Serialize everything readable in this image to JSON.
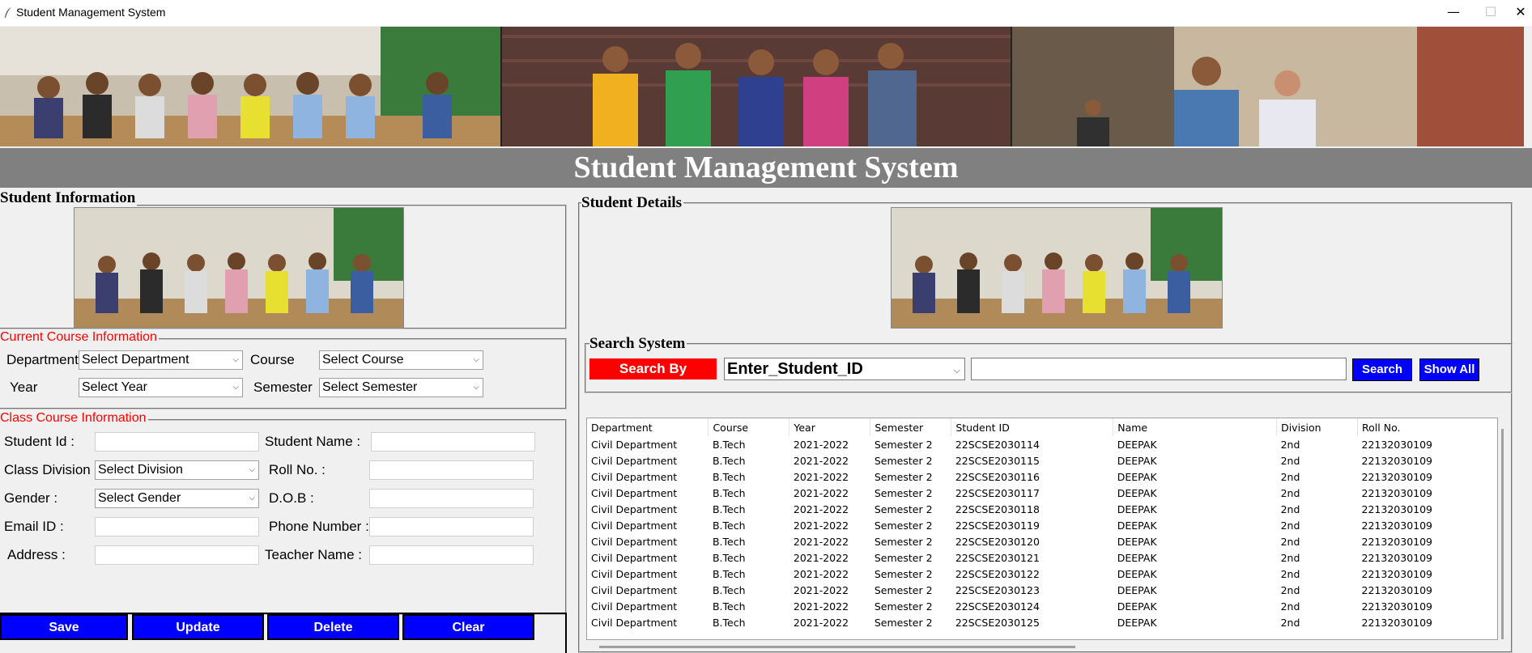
{
  "window": {
    "title": "Student Management System",
    "controls": {
      "minimize": "—",
      "maximize": "☐",
      "close": "✕"
    }
  },
  "header": {
    "title": "Student Management System"
  },
  "student_info": {
    "frame_title": "Student Information",
    "current_course": {
      "title": "Current Course Information",
      "department_label": "Department",
      "department_value": "Select Department",
      "course_label": "Course",
      "course_value": "Select Course",
      "year_label": "Year",
      "year_value": "Select Year",
      "semester_label": "Semester",
      "semester_value": "Select Semester"
    },
    "class_course": {
      "title": "Class Course Information",
      "student_id_label": "Student Id :",
      "student_name_label": "Student Name :",
      "class_division_label": "Class Division :",
      "class_division_value": "Select Division",
      "roll_no_label": "Roll No. :",
      "gender_label": "Gender :",
      "gender_value": "Select Gender",
      "dob_label": "D.O.B :",
      "email_label": "Email ID :",
      "phone_label": "Phone Number :",
      "address_label": "Address :",
      "teacher_label": "Teacher Name :"
    },
    "buttons": {
      "save": "Save",
      "update": "Update",
      "delete": "Delete",
      "clear": "Clear"
    }
  },
  "student_details": {
    "frame_title": "Student Details",
    "search": {
      "title": "Search System",
      "search_by_label": "Search By",
      "search_by_value": "Enter_Student_ID",
      "search_value": "",
      "search_button": "Search",
      "show_all_button": "Show All"
    },
    "table": {
      "columns": [
        "Department",
        "Course",
        "Year",
        "Semester",
        "Student ID",
        "Name",
        "Division",
        "Roll No."
      ],
      "rows": [
        [
          "Civil Department",
          "B.Tech",
          "2021-2022",
          "Semester 2",
          "22SCSE2030114",
          "DEEPAK",
          "2nd",
          "22132030109"
        ],
        [
          "Civil Department",
          "B.Tech",
          "2021-2022",
          "Semester 2",
          "22SCSE2030115",
          "DEEPAK",
          "2nd",
          "22132030109"
        ],
        [
          "Civil Department",
          "B.Tech",
          "2021-2022",
          "Semester 2",
          "22SCSE2030116",
          "DEEPAK",
          "2nd",
          "22132030109"
        ],
        [
          "Civil Department",
          "B.Tech",
          "2021-2022",
          "Semester 2",
          "22SCSE2030117",
          "DEEPAK",
          "2nd",
          "22132030109"
        ],
        [
          "Civil Department",
          "B.Tech",
          "2021-2022",
          "Semester 2",
          "22SCSE2030118",
          "DEEPAK",
          "2nd",
          "22132030109"
        ],
        [
          "Civil Department",
          "B.Tech",
          "2021-2022",
          "Semester 2",
          "22SCSE2030119",
          "DEEPAK",
          "2nd",
          "22132030109"
        ],
        [
          "Civil Department",
          "B.Tech",
          "2021-2022",
          "Semester 2",
          "22SCSE2030120",
          "DEEPAK",
          "2nd",
          "22132030109"
        ],
        [
          "Civil Department",
          "B.Tech",
          "2021-2022",
          "Semester 2",
          "22SCSE2030121",
          "DEEPAK",
          "2nd",
          "22132030109"
        ],
        [
          "Civil Department",
          "B.Tech",
          "2021-2022",
          "Semester 2",
          "22SCSE2030122",
          "DEEPAK",
          "2nd",
          "22132030109"
        ],
        [
          "Civil Department",
          "B.Tech",
          "2021-2022",
          "Semester 2",
          "22SCSE2030123",
          "DEEPAK",
          "2nd",
          "22132030109"
        ],
        [
          "Civil Department",
          "B.Tech",
          "2021-2022",
          "Semester 2",
          "22SCSE2030124",
          "DEEPAK",
          "2nd",
          "22132030109"
        ],
        [
          "Civil Department",
          "B.Tech",
          "2021-2022",
          "Semester 2",
          "22SCSE2030125",
          "DEEPAK",
          "2nd",
          "22132030109"
        ]
      ]
    }
  },
  "colors": {
    "accent_blue": "#0000ff",
    "accent_red": "#ff0000",
    "header_gray": "#808080"
  },
  "icons": {
    "app": "feather-icon",
    "dropdown": "chevron-down-icon"
  }
}
